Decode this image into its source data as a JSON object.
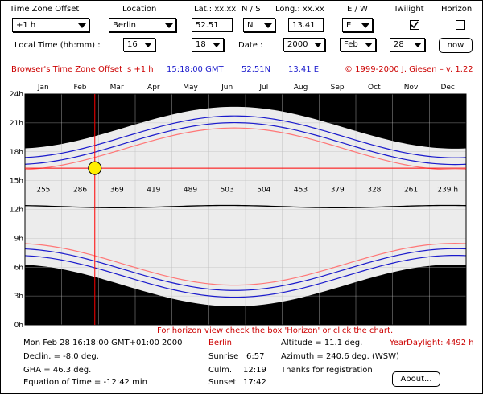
{
  "controls": {
    "tz_label": "Time Zone Offset",
    "tz_value": "+1 h",
    "location_label": "Location",
    "location_value": "Berlin",
    "lat_label": "Lat.: xx.xx",
    "lat_value": "52.51",
    "ns_label": "N / S",
    "ns_value": "N",
    "long_label": "Long.: xx.xx",
    "long_value": "13.41",
    "ew_label": "E / W",
    "ew_value": "E",
    "twilight_label": "Twilight",
    "horizon_label": "Horizon",
    "local_time_label": "Local Time (hh:mm) :",
    "hour_value": "16",
    "minute_value": "18",
    "date_label": "Date :",
    "year_value": "2000",
    "month_value": "Feb",
    "day_value": "28",
    "now_label": "now"
  },
  "status": {
    "tz_msg": "Browser's Time Zone Offset is +1 h",
    "gmt": "15:18:00 GMT",
    "lat": "52.51N",
    "long": "13.41 E",
    "copyright": "© 1999-2000 J. Giesen – v. 1.22"
  },
  "chart_data": {
    "type": "line",
    "months": [
      "Jan",
      "Feb",
      "Mar",
      "Apr",
      "May",
      "Jun",
      "Jul",
      "Aug",
      "Sep",
      "Oct",
      "Nov",
      "Dec"
    ],
    "y_ticks": [
      "0h",
      "3h",
      "6h",
      "9h",
      "12h",
      "15h",
      "18h",
      "21h",
      "24h"
    ],
    "ylim": [
      0,
      24
    ],
    "daylight_minutes": [
      "255",
      "286",
      "369",
      "419",
      "489",
      "503",
      "504",
      "453",
      "379",
      "328",
      "261",
      "239 h"
    ],
    "cursor": {
      "month_fraction": 1.9,
      "hour": 16.3
    },
    "colors": {
      "night": "#000000",
      "day": "#ececec",
      "twilight": "#ffffff",
      "blue": "#1a1acc",
      "pink": "#ff7777",
      "cursor": "#ff0000",
      "sun": "#ffee00"
    }
  },
  "hint": "For horizon view check the box 'Horizon' or click the chart.",
  "info": {
    "datetime": "Mon Feb 28 16:18:00 GMT+01:00 2000",
    "place": "Berlin",
    "year_daylight": "YearDaylight: 4492 h",
    "declination": "Declin. = -8.0 deg.",
    "gha": "GHA    = 46.3 deg.",
    "eot": "Equation of Time = -12:42 min",
    "sunrise_label": "Sunrise",
    "sunrise": "6:57",
    "culm_label": "Culm.",
    "culm": "12:19",
    "sunset_label": "Sunset",
    "sunset": "17:42",
    "altitude": "Altitude = 11.1 deg.",
    "azimuth": "Azimuth = 240.6 deg. (WSW)",
    "thanks": "Thanks for registration",
    "about_label": "About..."
  }
}
